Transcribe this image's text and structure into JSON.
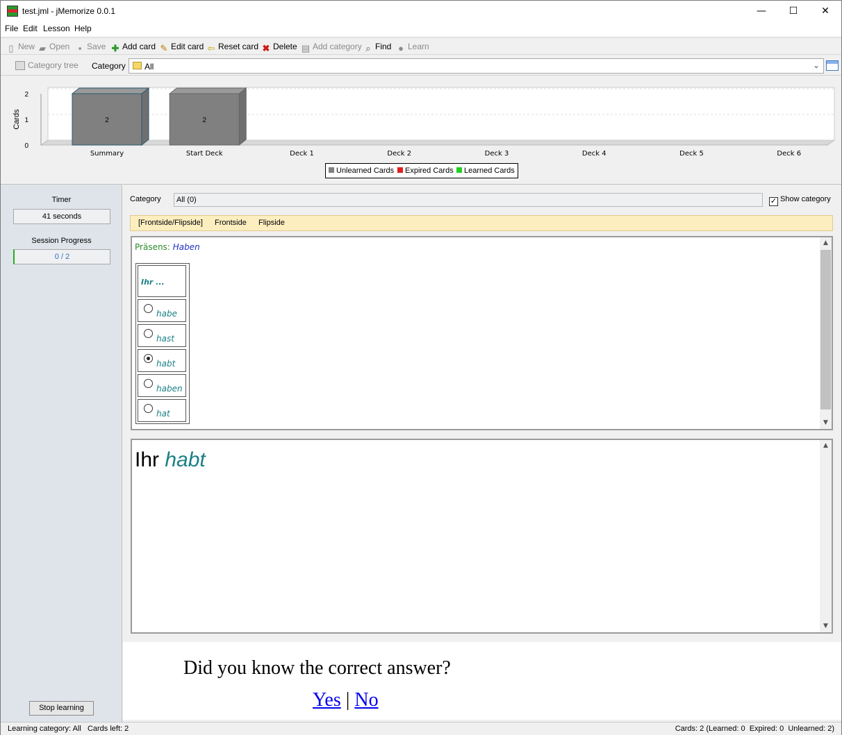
{
  "window": {
    "title": "test.jml - jMemorize 0.0.1",
    "minimize": "—",
    "maximize": "☐",
    "close": "✕"
  },
  "menu": [
    "File",
    "Edit",
    "Lesson",
    "Help"
  ],
  "toolbar": {
    "new": "New",
    "open": "Open",
    "save": "Save",
    "add_card": "Add card",
    "edit_card": "Edit card",
    "reset_card": "Reset card",
    "delete": "Delete",
    "add_category": "Add category",
    "find": "Find",
    "learn": "Learn"
  },
  "category_bar": {
    "tree_label": "Category tree",
    "category_label": "Category",
    "selected": "All"
  },
  "chart_data": {
    "type": "bar",
    "ylabel": "Cards",
    "ylim": [
      0,
      2
    ],
    "yticks": [
      "0",
      "1",
      "2"
    ],
    "categories": [
      "Summary",
      "Start Deck",
      "Deck 1",
      "Deck 2",
      "Deck 3",
      "Deck 4",
      "Deck 5",
      "Deck 6"
    ],
    "values": [
      2,
      2,
      0,
      0,
      0,
      0,
      0,
      0
    ],
    "labels": [
      "2",
      "2",
      "",
      "",
      "",
      "",
      "",
      ""
    ],
    "legend": [
      {
        "name": "Unlearned Cards",
        "color": "#808080"
      },
      {
        "name": "Expired Cards",
        "color": "#e02020"
      },
      {
        "name": "Learned Cards",
        "color": "#20d020"
      }
    ]
  },
  "left_panel": {
    "timer_label": "Timer",
    "timer_value": "41 seconds",
    "progress_label": "Session Progress",
    "progress_value": "0 / 2",
    "progress_fraction": 0,
    "stop_button": "Stop learning"
  },
  "main": {
    "category_label": "Category",
    "category_value": "All (0)",
    "show_category": "Show category",
    "tabs": [
      "[Frontside/Flipside]",
      "Frontside",
      "Flipside"
    ],
    "front": {
      "prefix": "Präsens:",
      "word": "Haben",
      "prompt": "Ihr ...",
      "options": [
        "habe",
        "hast",
        "habt",
        "haben",
        "hat"
      ],
      "selected_index": 2
    },
    "back": {
      "subject": "Ihr",
      "answer": "habt"
    }
  },
  "question": {
    "text": "Did you know the correct answer?",
    "yes": "Yes",
    "separator": "|",
    "no": "No"
  },
  "status": {
    "left": "Learning category: All   Cards left: 2",
    "right": "Cards: 2 (Learned: 0  Expired: 0  Unlearned: 2)"
  }
}
